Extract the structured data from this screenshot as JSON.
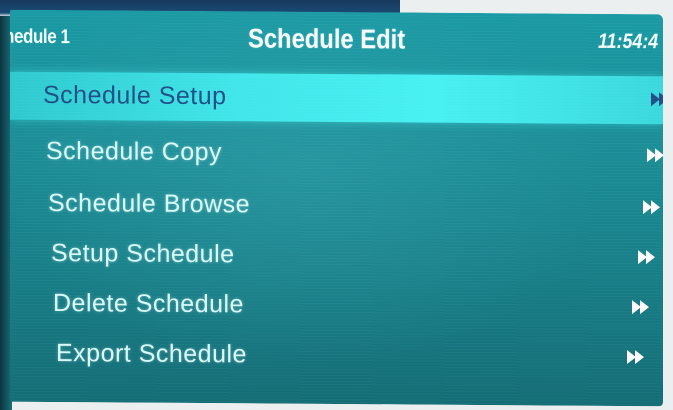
{
  "header": {
    "left_label": "hedule 1",
    "title": "Schedule Edit",
    "time": "11:54:4"
  },
  "menu": {
    "selected_index": 0,
    "items": [
      {
        "label": "Schedule Setup",
        "icon": "fast-forward-icon"
      },
      {
        "label": "Schedule Copy",
        "icon": "fast-forward-icon"
      },
      {
        "label": "Schedule Browse",
        "icon": "fast-forward-icon"
      },
      {
        "label": "Setup Schedule",
        "icon": "fast-forward-icon"
      },
      {
        "label": "Delete Schedule",
        "icon": "fast-forward-icon"
      },
      {
        "label": "Export Schedule",
        "icon": "fast-forward-icon"
      }
    ]
  },
  "colors": {
    "screen": "#1b8d96",
    "highlight": "#40e6ea",
    "selected_text": "#1f4f86",
    "text": "#d7fbfb"
  }
}
